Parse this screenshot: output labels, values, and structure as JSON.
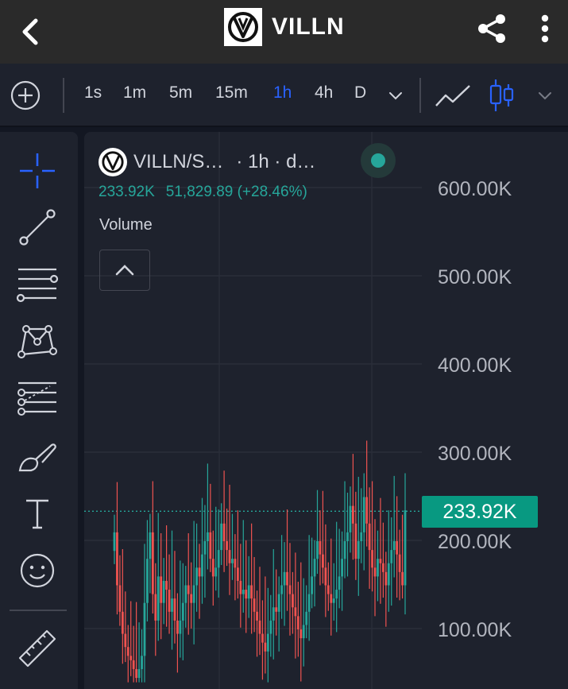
{
  "header": {
    "brand_name": "VILLN",
    "back_icon": "chevron-left-icon",
    "share_icon": "share-icon",
    "more_icon": "more-vertical-icon"
  },
  "toolbar": {
    "timeframes": [
      "1s",
      "1m",
      "5m",
      "15m",
      "1h",
      "4h",
      "D"
    ],
    "active_timeframe": "1h",
    "accent": "#2962ff"
  },
  "drawing_tools": [
    "crosshair-icon",
    "trend-line-icon",
    "horizontal-lines-icon",
    "pattern-icon",
    "fib-retracement-icon",
    "brush-icon",
    "text-icon",
    "emoji-icon",
    "ruler-icon"
  ],
  "legend": {
    "symbol": "VILLN/S…",
    "details": "· 1h · d…",
    "last_price": "233.92K",
    "change": "51,829.89 (+28.46%)",
    "study": "Volume"
  },
  "price_axis": {
    "labels": [
      "600.00K",
      "500.00K",
      "400.00K",
      "300.00K",
      "200.00K",
      "100.00K"
    ],
    "current": "233.92K"
  },
  "colors": {
    "up": "#26a69a",
    "down": "#ef5350",
    "background": "#131722",
    "panel": "#1e222d"
  },
  "chart_data": {
    "type": "candlestick",
    "interval": "1h",
    "y_unit": "K",
    "ylim": [
      40,
      640
    ],
    "last_price": 233.92,
    "closes": [
      210,
      150,
      120,
      95,
      80,
      70,
      65,
      55,
      45,
      55,
      70,
      130,
      180,
      210,
      140,
      110,
      160,
      130,
      155,
      145,
      120,
      135,
      110,
      95,
      110,
      130,
      150,
      140,
      130,
      150,
      170,
      160,
      185,
      200,
      210,
      180,
      160,
      170,
      190,
      220,
      200,
      190,
      175,
      180,
      170,
      155,
      140,
      145,
      135,
      150,
      135,
      120,
      110,
      95,
      85,
      75,
      95,
      110,
      125,
      120,
      140,
      150,
      165,
      150,
      140,
      125,
      115,
      100,
      90,
      105,
      120,
      140,
      160,
      180,
      200,
      185,
      170,
      150,
      140,
      130,
      135,
      145,
      160,
      180,
      200,
      210,
      240,
      220,
      180,
      200,
      210,
      250,
      220,
      190,
      170,
      160,
      180,
      175,
      165,
      150,
      175,
      190,
      200,
      185,
      165,
      150,
      235
    ]
  }
}
